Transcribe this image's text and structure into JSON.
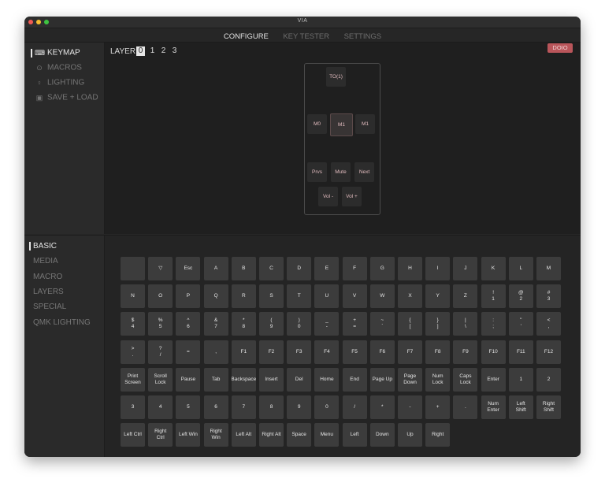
{
  "window_title": "VIA",
  "tabs": [
    {
      "label": "CONFIGURE"
    },
    {
      "label": "KEY TESTER"
    },
    {
      "label": "SETTINGS"
    }
  ],
  "sidebar": {
    "items": [
      {
        "label": "KEYMAP",
        "icon": "keyboard-icon"
      },
      {
        "label": "MACROS",
        "icon": "macro-circle-icon"
      },
      {
        "label": "LIGHTING",
        "icon": "lightbulb-icon"
      },
      {
        "label": "SAVE + LOAD",
        "icon": "save-icon"
      }
    ]
  },
  "layer_selector": {
    "label": "LAYER",
    "layers": [
      "0",
      "1",
      "2",
      "3"
    ],
    "active": "0"
  },
  "brand_badge": "DOIO",
  "device_keys": [
    "TO(1)",
    "M0",
    "M1",
    "M1",
    "Prvs",
    "Mute",
    "Next",
    "Vol -",
    "Vol +"
  ],
  "categories": [
    "BASIC",
    "MEDIA",
    "MACRO",
    "LAYERS",
    "SPECIAL",
    "QMK LIGHTING"
  ],
  "key_rows": [
    [
      "",
      "▽",
      "Esc",
      "A",
      "B",
      "C",
      "D",
      "E",
      "F",
      "G",
      "H",
      "I",
      "J",
      "K",
      "L",
      "M"
    ],
    [
      "N",
      "O",
      "P",
      "Q",
      "R",
      "S",
      "T",
      "U",
      "V",
      "W",
      "X",
      "Y",
      "Z",
      "!\n1",
      "@\n2",
      "#\n3"
    ],
    [
      "$\n4",
      "%\n5",
      "^\n6",
      "&\n7",
      "*\n8",
      "(\n9",
      ")\n0",
      "_\n-",
      "+\n=",
      "~\n`",
      "{\n[",
      "}\n]",
      "|\n\\",
      ":\n;",
      "\"\n'",
      "<\n,"
    ],
    [
      ">\n.",
      "?\n/",
      "=",
      ",",
      "F1",
      "F2",
      "F3",
      "F4",
      "F5",
      "F6",
      "F7",
      "F8",
      "F9",
      "F10",
      "F11",
      "F12"
    ],
    [
      "Print\nScreen",
      "Scroll\nLock",
      "Pause",
      "Tab",
      "Backspace",
      "Insert",
      "Del",
      "Home",
      "End",
      "Page Up",
      "Page\nDown",
      "Num\nLock",
      "Caps\nLock",
      "Enter",
      "1",
      "2"
    ],
    [
      "3",
      "4",
      "5",
      "6",
      "7",
      "8",
      "9",
      "0",
      "/",
      "*",
      "-",
      "+",
      ".",
      "Num\nEnter",
      "Left\nShift",
      "Right\nShift"
    ],
    [
      "Left Ctrl",
      "Right\nCtrl",
      "Left Win",
      "Right\nWin",
      "Left Alt",
      "Right Alt",
      "Space",
      "Menu",
      "Left",
      "Down",
      "Up",
      "Right"
    ]
  ]
}
